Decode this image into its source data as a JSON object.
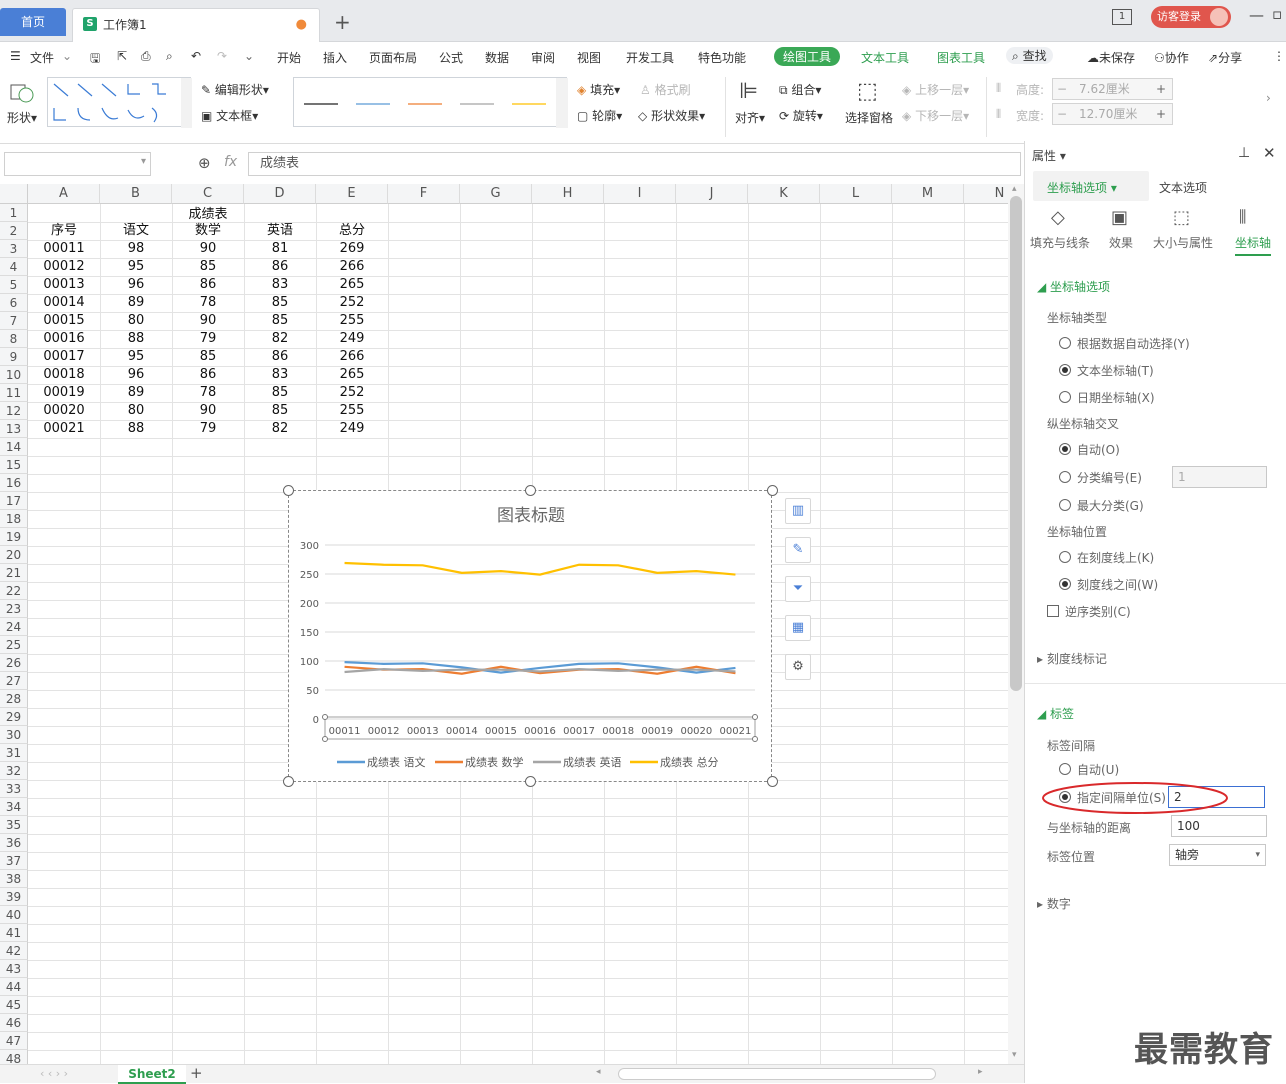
{
  "titlebar": {
    "home_tab": "首页",
    "doc_tab": "工作簿1",
    "login": "访客登录"
  },
  "menu": {
    "file": "文件",
    "items": [
      "开始",
      "插入",
      "页面布局",
      "公式",
      "数据",
      "审阅",
      "视图",
      "开发工具",
      "特色功能"
    ],
    "drawing_tools": "绘图工具",
    "text_tools": "文本工具",
    "chart_tools": "图表工具",
    "search": "查找",
    "unsaved": "未保存",
    "collab": "协作",
    "share": "分享"
  },
  "ribbon": {
    "shape": "形状",
    "edit_shape": "编辑形状",
    "textbox": "文本框",
    "fill": "填充",
    "format_painter": "格式刷",
    "outline": "轮廓",
    "shape_effect": "形状效果",
    "align": "对齐",
    "group": "组合",
    "rotate": "旋转",
    "select_pane": "选择窗格",
    "bring_forward": "上移一层",
    "send_backward": "下移一层",
    "height_label": "高度:",
    "width_label": "宽度:",
    "height_value": "7.62厘米",
    "width_value": "12.70厘米"
  },
  "formula": {
    "fx": "fx",
    "content": "成绩表"
  },
  "sheet": {
    "columns": [
      "A",
      "B",
      "C",
      "D",
      "E",
      "F",
      "G",
      "H",
      "I",
      "J",
      "K",
      "L",
      "M",
      "N"
    ],
    "rows": [
      "1",
      "2",
      "3",
      "4",
      "5",
      "6",
      "7",
      "8",
      "9",
      "10",
      "11",
      "12",
      "13",
      "14",
      "15",
      "16",
      "17",
      "18",
      "19",
      "20",
      "21",
      "22",
      "23",
      "24",
      "25",
      "26",
      "27",
      "28",
      "29",
      "30",
      "31",
      "32",
      "33",
      "34",
      "35",
      "36",
      "37",
      "38",
      "39",
      "40",
      "41",
      "42",
      "43",
      "44",
      "45",
      "46",
      "47",
      "48"
    ],
    "title": "成绩表",
    "headers": [
      "序号",
      "语文",
      "数学",
      "英语",
      "总分"
    ],
    "data": [
      [
        "00011",
        "98",
        "90",
        "81",
        "269"
      ],
      [
        "00012",
        "95",
        "85",
        "86",
        "266"
      ],
      [
        "00013",
        "96",
        "86",
        "83",
        "265"
      ],
      [
        "00014",
        "89",
        "78",
        "85",
        "252"
      ],
      [
        "00015",
        "80",
        "90",
        "85",
        "255"
      ],
      [
        "00016",
        "88",
        "79",
        "82",
        "249"
      ],
      [
        "00017",
        "95",
        "85",
        "86",
        "266"
      ],
      [
        "00018",
        "96",
        "86",
        "83",
        "265"
      ],
      [
        "00019",
        "89",
        "78",
        "85",
        "252"
      ],
      [
        "00020",
        "80",
        "90",
        "85",
        "255"
      ],
      [
        "00021",
        "88",
        "79",
        "82",
        "249"
      ]
    ],
    "sheet_tab": "Sheet2"
  },
  "chart_data": {
    "type": "line",
    "title": "图表标题",
    "categories": [
      "00011",
      "00012",
      "00013",
      "00014",
      "00015",
      "00016",
      "00017",
      "00018",
      "00019",
      "00020",
      "00021"
    ],
    "ylim": [
      0,
      300
    ],
    "yticks": [
      "0",
      "50",
      "100",
      "150",
      "200",
      "250",
      "300"
    ],
    "grid": true,
    "legend_position": "bottom",
    "series": [
      {
        "name": "成绩表 语文",
        "color": "#5b9bd5",
        "values": [
          98,
          95,
          96,
          89,
          80,
          88,
          95,
          96,
          89,
          80,
          88
        ]
      },
      {
        "name": "成绩表 数学",
        "color": "#ed7d31",
        "values": [
          90,
          85,
          86,
          78,
          90,
          79,
          85,
          86,
          78,
          90,
          79
        ]
      },
      {
        "name": "成绩表 英语",
        "color": "#a5a5a5",
        "values": [
          81,
          86,
          83,
          85,
          85,
          82,
          86,
          83,
          85,
          85,
          82
        ]
      },
      {
        "name": "成绩表 总分",
        "color": "#ffc000",
        "values": [
          269,
          266,
          265,
          252,
          255,
          249,
          266,
          265,
          252,
          255,
          249
        ]
      }
    ]
  },
  "panel": {
    "title": "属性",
    "tab_axis": "坐标轴选项",
    "tab_text": "文本选项",
    "sub_fill": "填充与线条",
    "sub_effect": "效果",
    "sub_size": "大小与属性",
    "sub_axis": "坐标轴",
    "sec_axis_options": "坐标轴选项",
    "axis_type": "坐标轴类型",
    "opt_auto_select": "根据数据自动选择(Y)",
    "opt_text_axis": "文本坐标轴(T)",
    "opt_date_axis": "日期坐标轴(X)",
    "v_cross": "纵坐标轴交叉",
    "opt_auto": "自动(O)",
    "opt_cat_num": "分类编号(E)",
    "cat_num_value": "1",
    "opt_max_cat": "最大分类(G)",
    "axis_pos": "坐标轴位置",
    "opt_on_tick": "在刻度线上(K)",
    "opt_between": "刻度线之间(W)",
    "reverse": "逆序类别(C)",
    "tick_marks": "刻度线标记",
    "labels": "标签",
    "label_interval": "标签间隔",
    "opt_interval_auto": "自动(U)",
    "opt_interval_spec": "指定间隔单位(S)",
    "interval_value": "2",
    "distance_label": "与坐标轴的距离",
    "distance_value": "100",
    "label_pos": "标签位置",
    "label_pos_value": "轴旁",
    "number": "数字"
  },
  "watermark": "最需教育",
  "colors": {
    "accent_green": "#2e9e4f",
    "home_tab": "#4a7fd6",
    "annotation_red": "#d9292b"
  }
}
